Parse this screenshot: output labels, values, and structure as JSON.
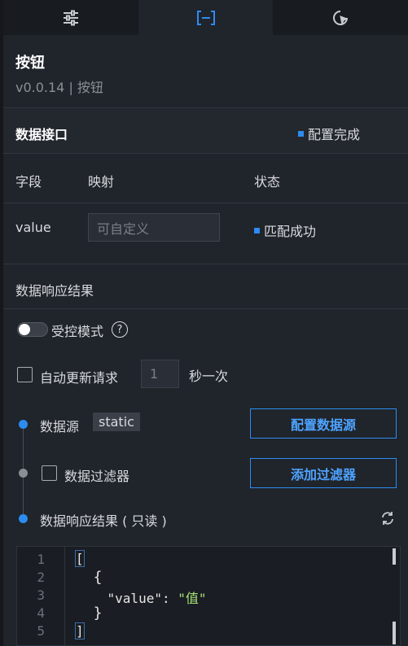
{
  "tabs": [
    {
      "name": "style",
      "icon": "sliders-icon"
    },
    {
      "name": "data",
      "icon": "data-bracket-icon"
    },
    {
      "name": "interaction",
      "icon": "cursor-icon"
    }
  ],
  "header": {
    "title": "按钮",
    "subtitle": "v0.0.14 | 按钮"
  },
  "data_interface": {
    "label": "数据接口",
    "status": "配置完成"
  },
  "fields": {
    "headers": {
      "field": "字段",
      "mapping": "映射",
      "status": "状态"
    },
    "rows": [
      {
        "field": "value",
        "placeholder": "可自定义",
        "status": "匹配成功"
      }
    ]
  },
  "response_section": {
    "label": "数据响应结果"
  },
  "controlled": {
    "label": "受控模式",
    "help": "?"
  },
  "auto_update": {
    "label": "自动更新请求",
    "value": "1",
    "unit": "秒一次"
  },
  "datasource": {
    "label": "数据源",
    "type": "static",
    "button": "配置数据源"
  },
  "filter": {
    "label": "数据过滤器",
    "button": "添加过滤器"
  },
  "result": {
    "label": "数据响应结果 ( 只读 )"
  },
  "code": {
    "line_numbers": [
      "1",
      "2",
      "3",
      "4",
      "5"
    ],
    "lines": [
      "[",
      "  {",
      "    \"value\": ",
      "  }",
      "]"
    ],
    "value_string": "\"值\""
  },
  "colors": {
    "accent": "#2d8cf0",
    "background": "#20242b"
  }
}
